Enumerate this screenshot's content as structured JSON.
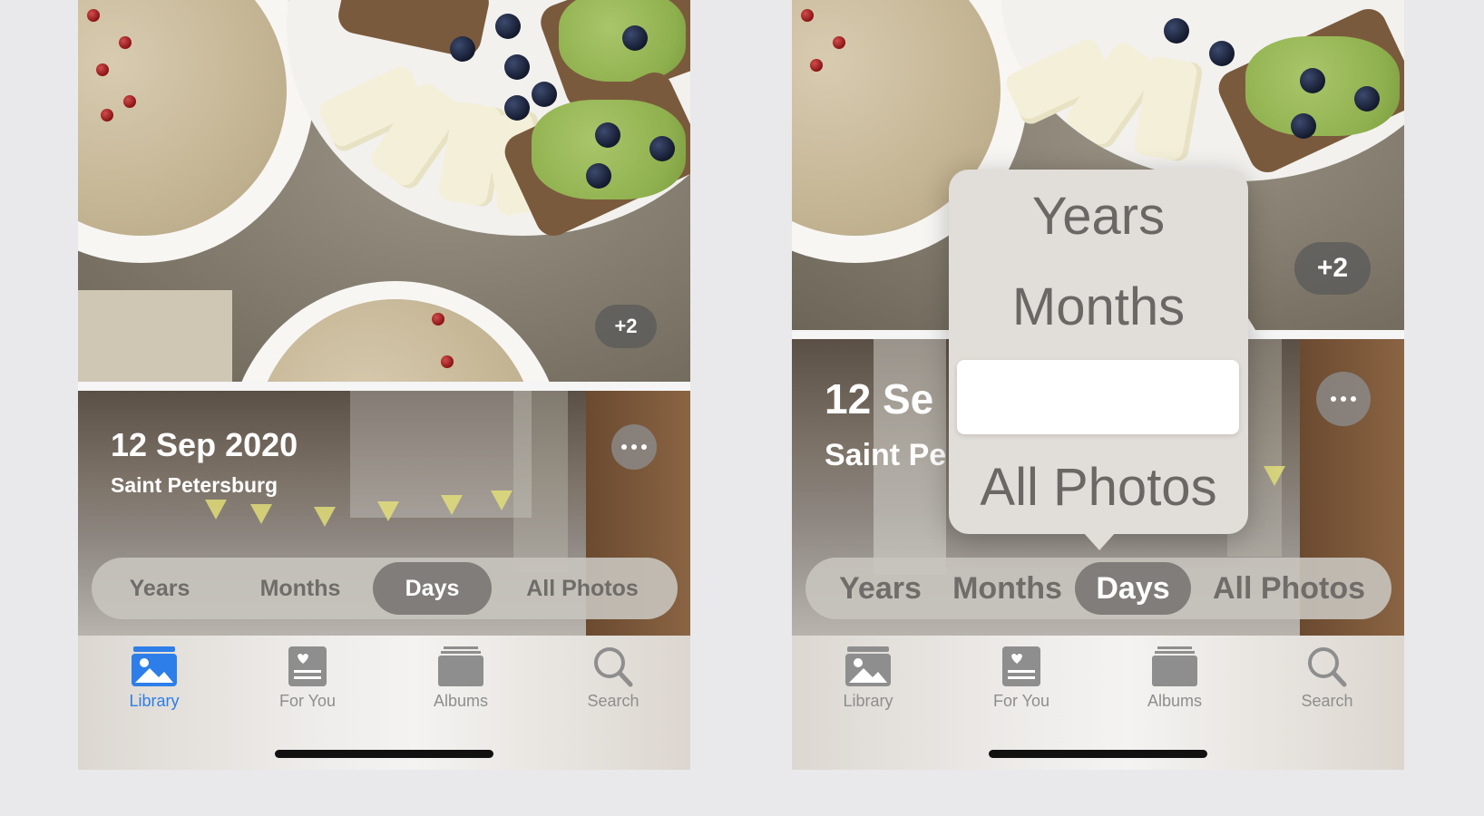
{
  "left": {
    "badge": "+2",
    "date": "12 Sep 2020",
    "place": "Saint Petersburg",
    "segments": [
      "Years",
      "Months",
      "Days",
      "All Photos"
    ],
    "selected_segment": "Days",
    "tabs": [
      "Library",
      "For You",
      "Albums",
      "Search"
    ],
    "active_tab": "Library"
  },
  "right": {
    "badge": "+2",
    "date": "12 Se",
    "place": "Saint Pe",
    "segments": [
      "Years",
      "Months",
      "Days",
      "All Photos"
    ],
    "selected_segment": "Days",
    "popover": [
      "Years",
      "Months",
      "",
      "All Photos"
    ],
    "tabs": [
      "Library",
      "For You",
      "Albums",
      "Search"
    ]
  },
  "colors": {
    "accent": "#2d7ee8",
    "tab_inactive": "#8e8e8e",
    "segment_bg": "#c8c4be",
    "segment_selected": "#807d7a"
  },
  "icons": [
    "ellipsis-icon",
    "library-photos-icon",
    "for-you-icon",
    "albums-icon",
    "search-icon"
  ]
}
